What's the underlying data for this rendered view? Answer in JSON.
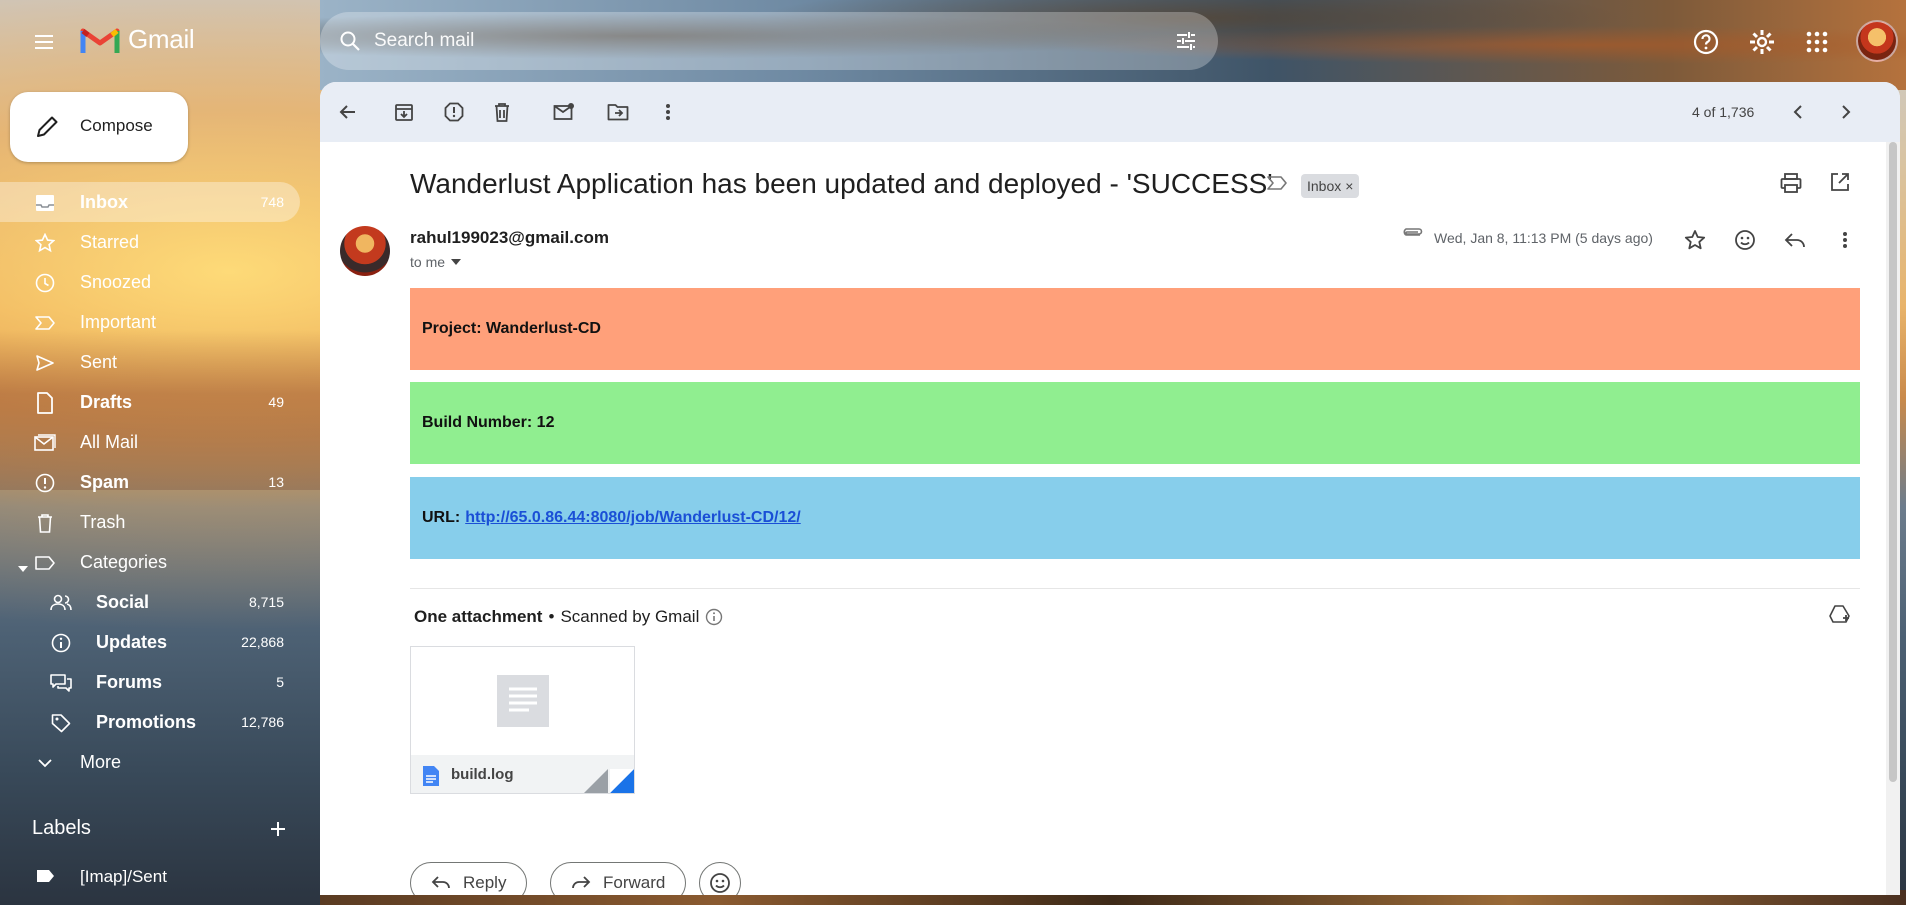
{
  "app": {
    "logo_text": "Gmail"
  },
  "search": {
    "placeholder": "Search mail"
  },
  "compose": {
    "label": "Compose"
  },
  "nav": {
    "items": [
      {
        "label": "Inbox",
        "count": "748"
      },
      {
        "label": "Starred",
        "count": ""
      },
      {
        "label": "Snoozed",
        "count": ""
      },
      {
        "label": "Important",
        "count": ""
      },
      {
        "label": "Sent",
        "count": ""
      },
      {
        "label": "Drafts",
        "count": "49"
      },
      {
        "label": "All Mail",
        "count": ""
      },
      {
        "label": "Spam",
        "count": "13"
      },
      {
        "label": "Trash",
        "count": ""
      },
      {
        "label": "Categories",
        "count": ""
      },
      {
        "label": "Social",
        "count": "8,715"
      },
      {
        "label": "Updates",
        "count": "22,868"
      },
      {
        "label": "Forums",
        "count": "5"
      },
      {
        "label": "Promotions",
        "count": "12,786"
      },
      {
        "label": "More",
        "count": ""
      }
    ]
  },
  "labels": {
    "title": "Labels",
    "items": [
      {
        "label": "[Imap]/Sent"
      }
    ]
  },
  "toolbar": {
    "pager": "4 of 1,736"
  },
  "email": {
    "subject": "Wanderlust Application has been updated and deployed - 'SUCCESS'",
    "chip": "Inbox",
    "chip_close": "×",
    "sender": "rahul199023@gmail.com",
    "to": "to me",
    "date": "Wed, Jan 8, 11:13 PM (5 days ago)",
    "bands": [
      {
        "text": "Project: Wanderlust-CD",
        "color": "#FFA07A"
      },
      {
        "text": "Build Number: 12",
        "color": "#90EE90"
      },
      {
        "label": "URL:",
        "link": "http://65.0.86.44:8080/job/Wanderlust-CD/12/",
        "color": "#87CEEB"
      }
    ],
    "attachment_heading": "One attachment",
    "attachment_sep": "•",
    "scanned": "Scanned by Gmail",
    "attachment_name": "build.log"
  },
  "actions": {
    "reply": "Reply",
    "forward": "Forward"
  },
  "colors": {
    "accent_blue": "#1a73e8"
  }
}
